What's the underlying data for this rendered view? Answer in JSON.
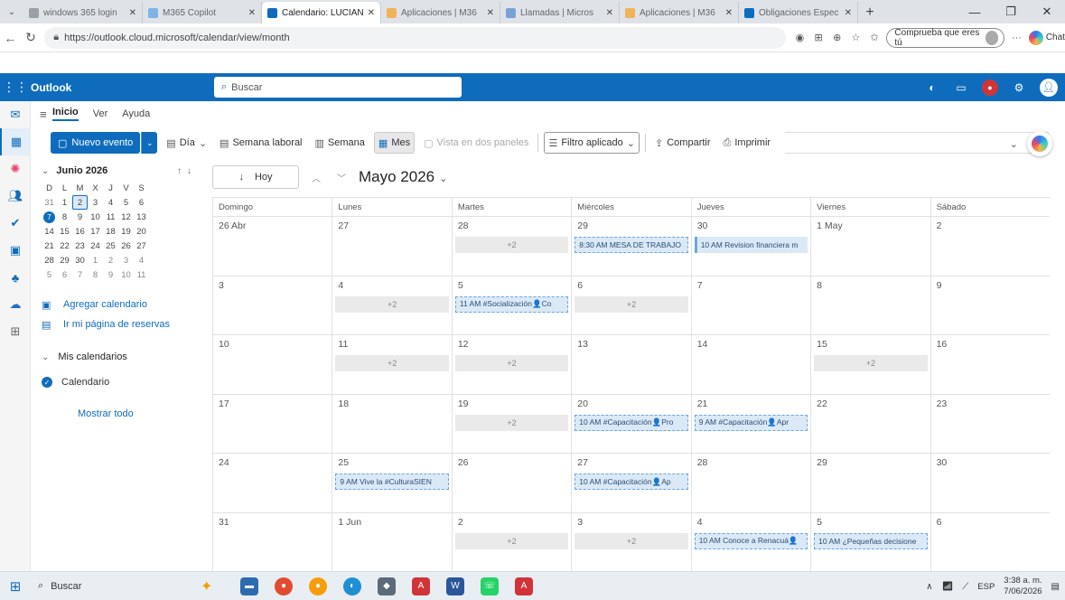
{
  "browser": {
    "tabs": [
      {
        "title": "windows 365 login",
        "active": false,
        "color": "#9aa0a6"
      },
      {
        "title": "M365 Copilot",
        "active": false,
        "color": "#7fb3e6"
      },
      {
        "title": "Calendario: LUCIAN",
        "active": true,
        "color": "#0f6cbd"
      },
      {
        "title": "Aplicaciones | M36",
        "active": false,
        "color": "#f0b35a"
      },
      {
        "title": "Llamadas | Micros",
        "active": false,
        "color": "#7aa1d6"
      },
      {
        "title": "Aplicaciones | M36",
        "active": false,
        "color": "#f0b35a"
      },
      {
        "title": "Obligaciones Espec",
        "active": false,
        "color": "#0f6cbd"
      }
    ],
    "url": "https://outlook.cloud.microsoft/calendar/view/month",
    "profile_label": "Comprueba que eres tú",
    "chat_label": "Chat"
  },
  "outlook": {
    "brand": "Outlook",
    "search_placeholder": "Buscar",
    "ribbon_tabs": [
      "Inicio",
      "Ver",
      "Ayuda"
    ],
    "toolbar": {
      "new_event": "Nuevo evento",
      "day": "Día",
      "work_week": "Semana laboral",
      "week": "Semana",
      "month": "Mes",
      "split_view": "Vista en dos paneles",
      "filter": "Filtro aplicado",
      "share": "Compartir",
      "print": "Imprimir"
    }
  },
  "mini_calendar": {
    "title": "Junio 2026",
    "weekday_initials": [
      "D",
      "L",
      "M",
      "X",
      "J",
      "V",
      "S"
    ],
    "rows": [
      [
        "31",
        "1",
        "2",
        "3",
        "4",
        "5",
        "6"
      ],
      [
        "7",
        "8",
        "9",
        "10",
        "11",
        "12",
        "13"
      ],
      [
        "14",
        "15",
        "16",
        "17",
        "18",
        "19",
        "20"
      ],
      [
        "21",
        "22",
        "23",
        "24",
        "25",
        "26",
        "27"
      ],
      [
        "28",
        "29",
        "30",
        "1",
        "2",
        "3",
        "4"
      ],
      [
        "5",
        "6",
        "7",
        "8",
        "9",
        "10",
        "11"
      ]
    ]
  },
  "left_nav": {
    "add_calendar": "Agregar calendario",
    "booking_page": "Ir mi página de reservas",
    "my_calendars": "Mis calendarios",
    "calendar_name": "Calendario",
    "show_all": "Mostrar todo"
  },
  "calendar": {
    "today_label": "Hoy",
    "month_title": "Mayo 2026",
    "days_of_week": [
      "Domingo",
      "Lunes",
      "Martes",
      "Miércoles",
      "Jueves",
      "Viernes",
      "Sábado"
    ],
    "weeks": [
      [
        {
          "d": "26 Abr"
        },
        {
          "d": "27"
        },
        {
          "d": "28",
          "more": "+2"
        },
        {
          "d": "29",
          "event": "8:30 AM MESA DE TRABAJO"
        },
        {
          "d": "30",
          "event": "10 AM Revision financiera m",
          "solid": true
        },
        {
          "d": "1 May"
        },
        {
          "d": "2"
        }
      ],
      [
        {
          "d": "3"
        },
        {
          "d": "4",
          "more": "+2"
        },
        {
          "d": "5",
          "event": "11 AM #Socialización👤Co"
        },
        {
          "d": "6",
          "more": "+2"
        },
        {
          "d": "7"
        },
        {
          "d": "8"
        },
        {
          "d": "9"
        }
      ],
      [
        {
          "d": "10"
        },
        {
          "d": "11",
          "more": "+2"
        },
        {
          "d": "12",
          "more": "+2"
        },
        {
          "d": "13"
        },
        {
          "d": "14"
        },
        {
          "d": "15",
          "more": "+2"
        },
        {
          "d": "16"
        }
      ],
      [
        {
          "d": "17"
        },
        {
          "d": "18"
        },
        {
          "d": "19",
          "more": "+2"
        },
        {
          "d": "20",
          "event": "10 AM #Capacitación👤Pro"
        },
        {
          "d": "21",
          "event": "9 AM #Capacitación👤Apr"
        },
        {
          "d": "22"
        },
        {
          "d": "23"
        }
      ],
      [
        {
          "d": "24"
        },
        {
          "d": "25",
          "event": "9 AM Vive la #CulturaSIEN"
        },
        {
          "d": "26"
        },
        {
          "d": "27",
          "event": "10 AM #Capacitación👤Ap"
        },
        {
          "d": "28"
        },
        {
          "d": "29"
        },
        {
          "d": "30"
        }
      ],
      [
        {
          "d": "31"
        },
        {
          "d": "1 Jun"
        },
        {
          "d": "2",
          "more": "+2"
        },
        {
          "d": "3",
          "more": "+2"
        },
        {
          "d": "4",
          "event": "10 AM Conoce a Renacuá👤"
        },
        {
          "d": "5",
          "event": "10 AM ¿Pequeñas decisione"
        },
        {
          "d": "6"
        }
      ]
    ]
  },
  "taskbar": {
    "search_label": "Buscar",
    "language": "ESP",
    "time": "3:38 a. m.",
    "date": "7/06/2026"
  }
}
